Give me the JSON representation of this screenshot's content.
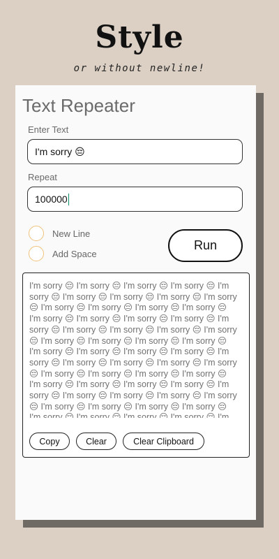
{
  "promo": {
    "headline": "Style",
    "subline": "or without newline!"
  },
  "app": {
    "title": "Text Repeater",
    "text_label": "Enter Text",
    "text_value": "I'm sorry 😔",
    "repeat_label": "Repeat",
    "repeat_value": "100000",
    "options": [
      {
        "label": "New Line",
        "checked": false
      },
      {
        "label": "Add Space",
        "checked": false
      }
    ],
    "run_label": "Run",
    "output_unit": "I'm sorry 😔",
    "actions": {
      "copy": "Copy",
      "clear": "Clear",
      "clear_clipboard": "Clear Clipboard"
    }
  },
  "colors": {
    "background": "#dcd0c5",
    "shadow": "#6f6a63",
    "radio_border": "#f0c27c",
    "caret": "#0a8f6b"
  }
}
